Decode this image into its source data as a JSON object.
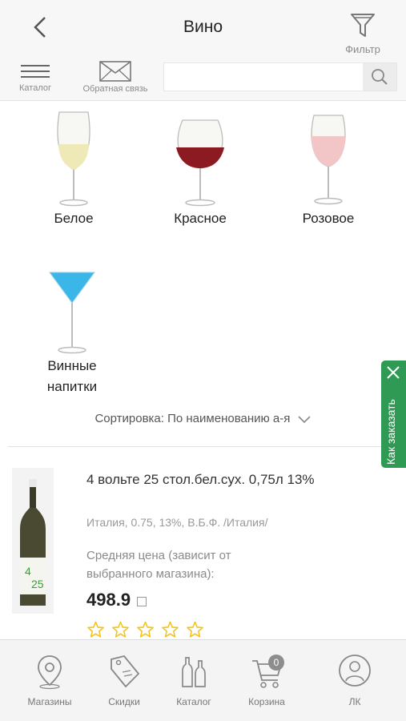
{
  "header": {
    "title": "Вино",
    "filter_label": "Фильтр"
  },
  "toolbar": {
    "catalog_label": "Каталог",
    "feedback_label": "Обратная связь",
    "search_placeholder": "",
    "search_value": ""
  },
  "categories": [
    {
      "label": "Белое",
      "icon": "white-wine-glass-icon"
    },
    {
      "label": "Красное",
      "icon": "red-wine-glass-icon"
    },
    {
      "label": "Розовое",
      "icon": "rose-wine-glass-icon"
    },
    {
      "label": "Винные\nнапитки",
      "icon": "cocktail-glass-icon"
    }
  ],
  "sort": {
    "label": "Сортировка: По наименованию а-я"
  },
  "products": [
    {
      "name": "4 вольте 25 стол.бел.сух. 0,75л 13%",
      "meta": "Италия, 0.75, 13%, В.Б.Ф. /Италия/",
      "price_note": "Средняя цена (зависит от выбранного магазина):",
      "price": "498.9",
      "rating": 0,
      "rating_max": 5
    }
  ],
  "side_tab": {
    "label": "Как заказать"
  },
  "bottom_nav": {
    "stores": "Магазины",
    "discounts": "Скидки",
    "catalog": "Каталог",
    "cart": "Корзина",
    "cart_count": "0",
    "account": "ЛК"
  },
  "colors": {
    "accent_green": "#2e9a53",
    "star_yellow": "#f2c318",
    "red_wine": "#8b1a22",
    "rose_wine": "#f2c6c6",
    "cocktail_blue": "#3bb6e8"
  }
}
